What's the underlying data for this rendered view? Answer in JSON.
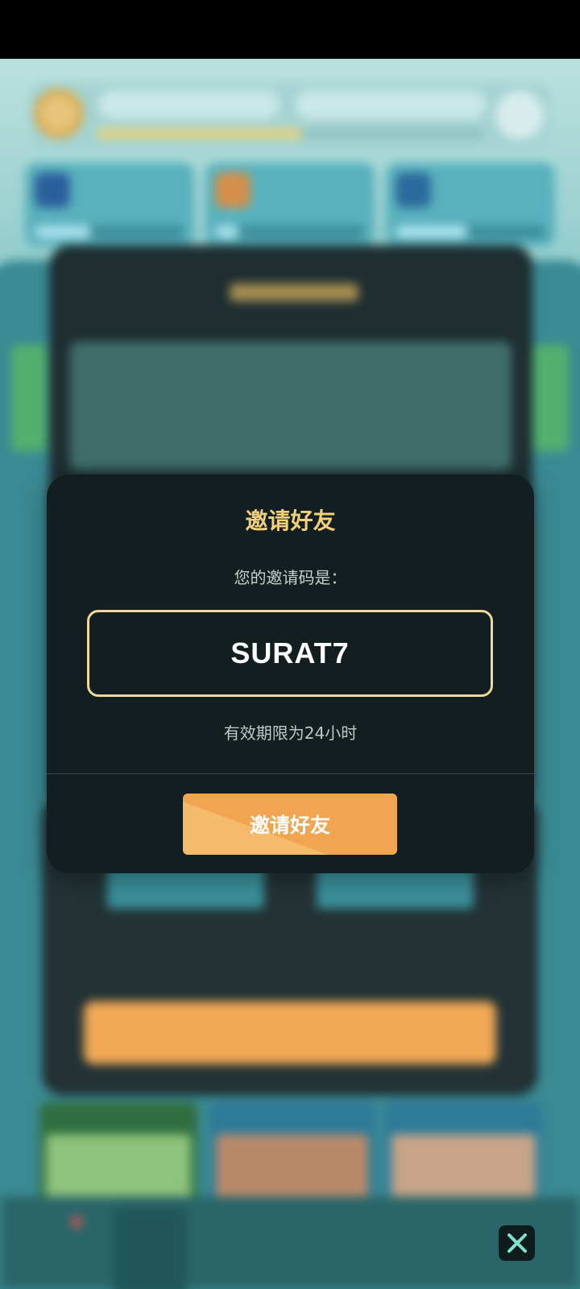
{
  "invite_modal": {
    "title": "邀请好友",
    "code_prompt": "您的邀请码是：",
    "invite_code": "SURAT7",
    "validity_note": "有效期限为24小时",
    "invite_button_label": "邀请好友"
  },
  "close_button": {
    "icon": "close-icon"
  },
  "bottom_nav": {
    "icons": [
      "triangle-icon",
      "shield-icon",
      "ring-icon",
      "gem-icon",
      "heart-icon"
    ]
  },
  "colors": {
    "title_gold": "#f3cf7a",
    "code_border": "#f1d79a",
    "button_orange": "#f1a550",
    "modal_background": "#121e1f",
    "close_icon": "#7fe0cd",
    "background_teal": "#3a8a93"
  }
}
